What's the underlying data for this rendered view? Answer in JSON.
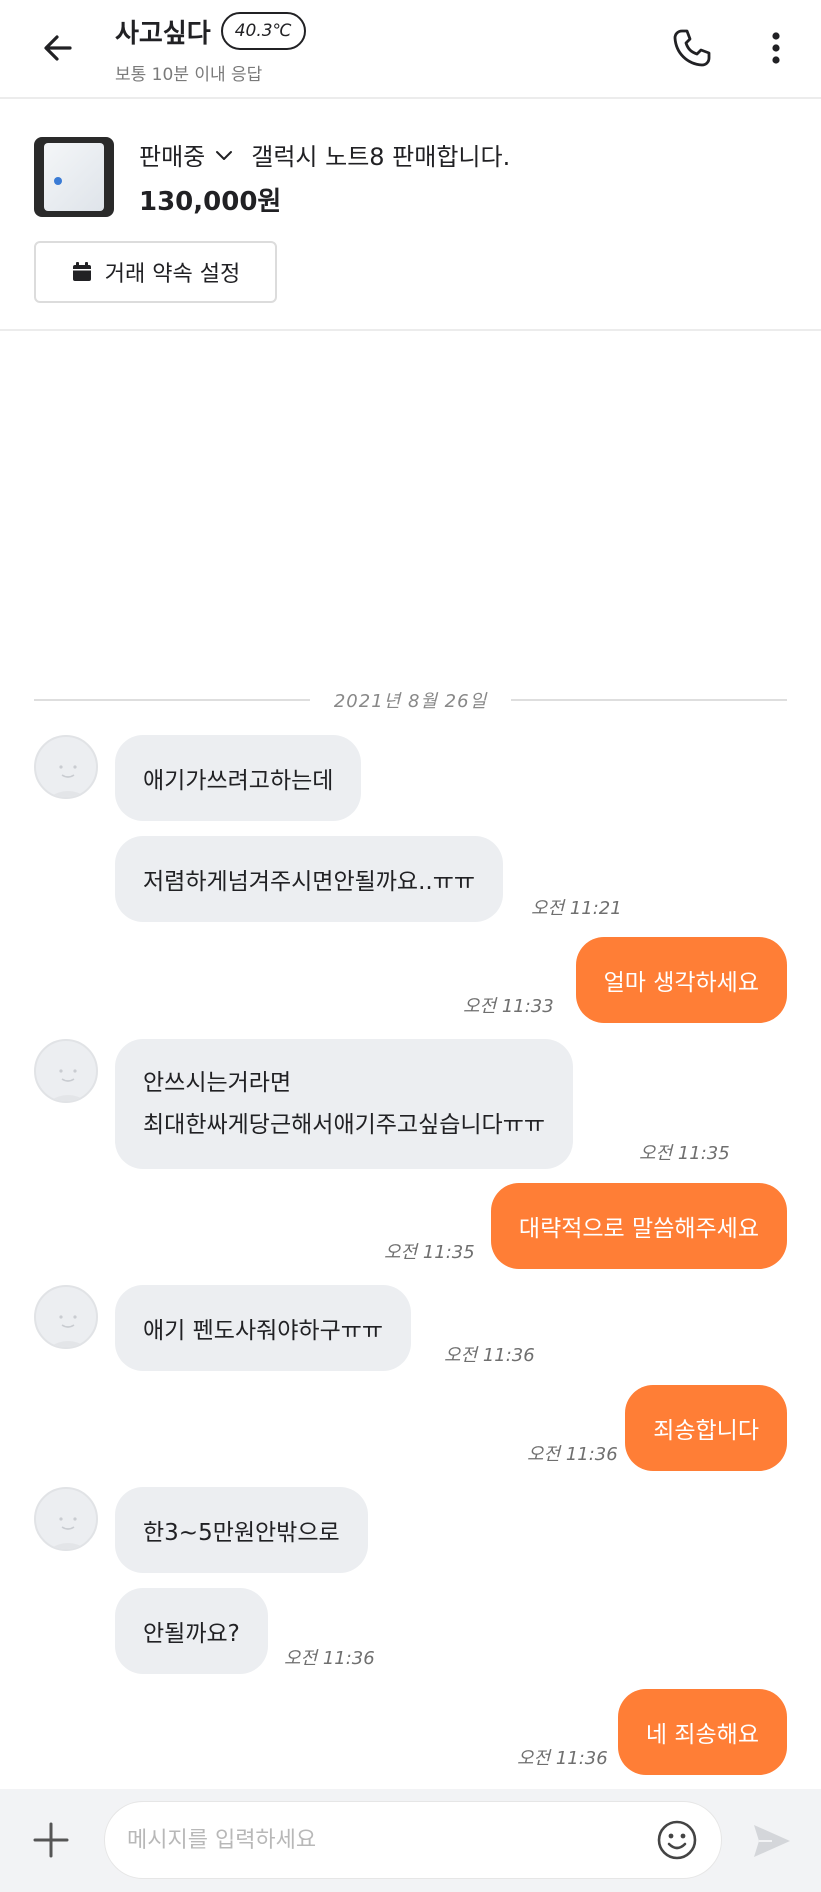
{
  "header": {
    "user_name": "사고싶다",
    "temperature": "40.3℃",
    "response_time": "보통 10분 이내 응답"
  },
  "product": {
    "status": "판매중",
    "title": "갤럭시 노트8 판매합니다.",
    "price": "130,000원",
    "appointment_label": "거래 약속 설정"
  },
  "chat": {
    "date": "2021년 8월 26일",
    "messages": [
      {
        "from": "other",
        "text": "애기가쓰려고하는데"
      },
      {
        "from": "other",
        "text": "저렴하게넘겨주시면안될까요..ㅠㅠ",
        "time": "오전 11:21"
      },
      {
        "from": "me",
        "text": "얼마 생각하세요",
        "time": "오전 11:33"
      },
      {
        "from": "other",
        "lines": [
          "안쓰시는거라면",
          "최대한싸게당근해서애기주고싶습니다ㅠㅠ"
        ],
        "time": "오전 11:35"
      },
      {
        "from": "me",
        "text": "대략적으로 말씀해주세요",
        "time": "오전 11:35"
      },
      {
        "from": "other",
        "text": "애기 펜도사줘야하구ㅠㅠ",
        "time": "오전 11:36"
      },
      {
        "from": "me",
        "text": "죄송합니다",
        "time": "오전 11:36"
      },
      {
        "from": "other",
        "text": "한3~5만원안밖으로"
      },
      {
        "from": "other",
        "text": "안될까요?",
        "time": "오전 11:36"
      },
      {
        "from": "me",
        "text": "네 죄송해요",
        "time": "오전 11:36"
      }
    ]
  },
  "input": {
    "placeholder": "메시지를 입력하세요"
  },
  "colors": {
    "accent": "#ff7e36",
    "incoming_bubble": "#eceef1"
  },
  "icons": [
    "back-arrow-icon",
    "phone-icon",
    "more-vertical-icon",
    "chevron-down-icon",
    "calendar-icon",
    "plus-icon",
    "emoji-icon",
    "send-icon"
  ]
}
